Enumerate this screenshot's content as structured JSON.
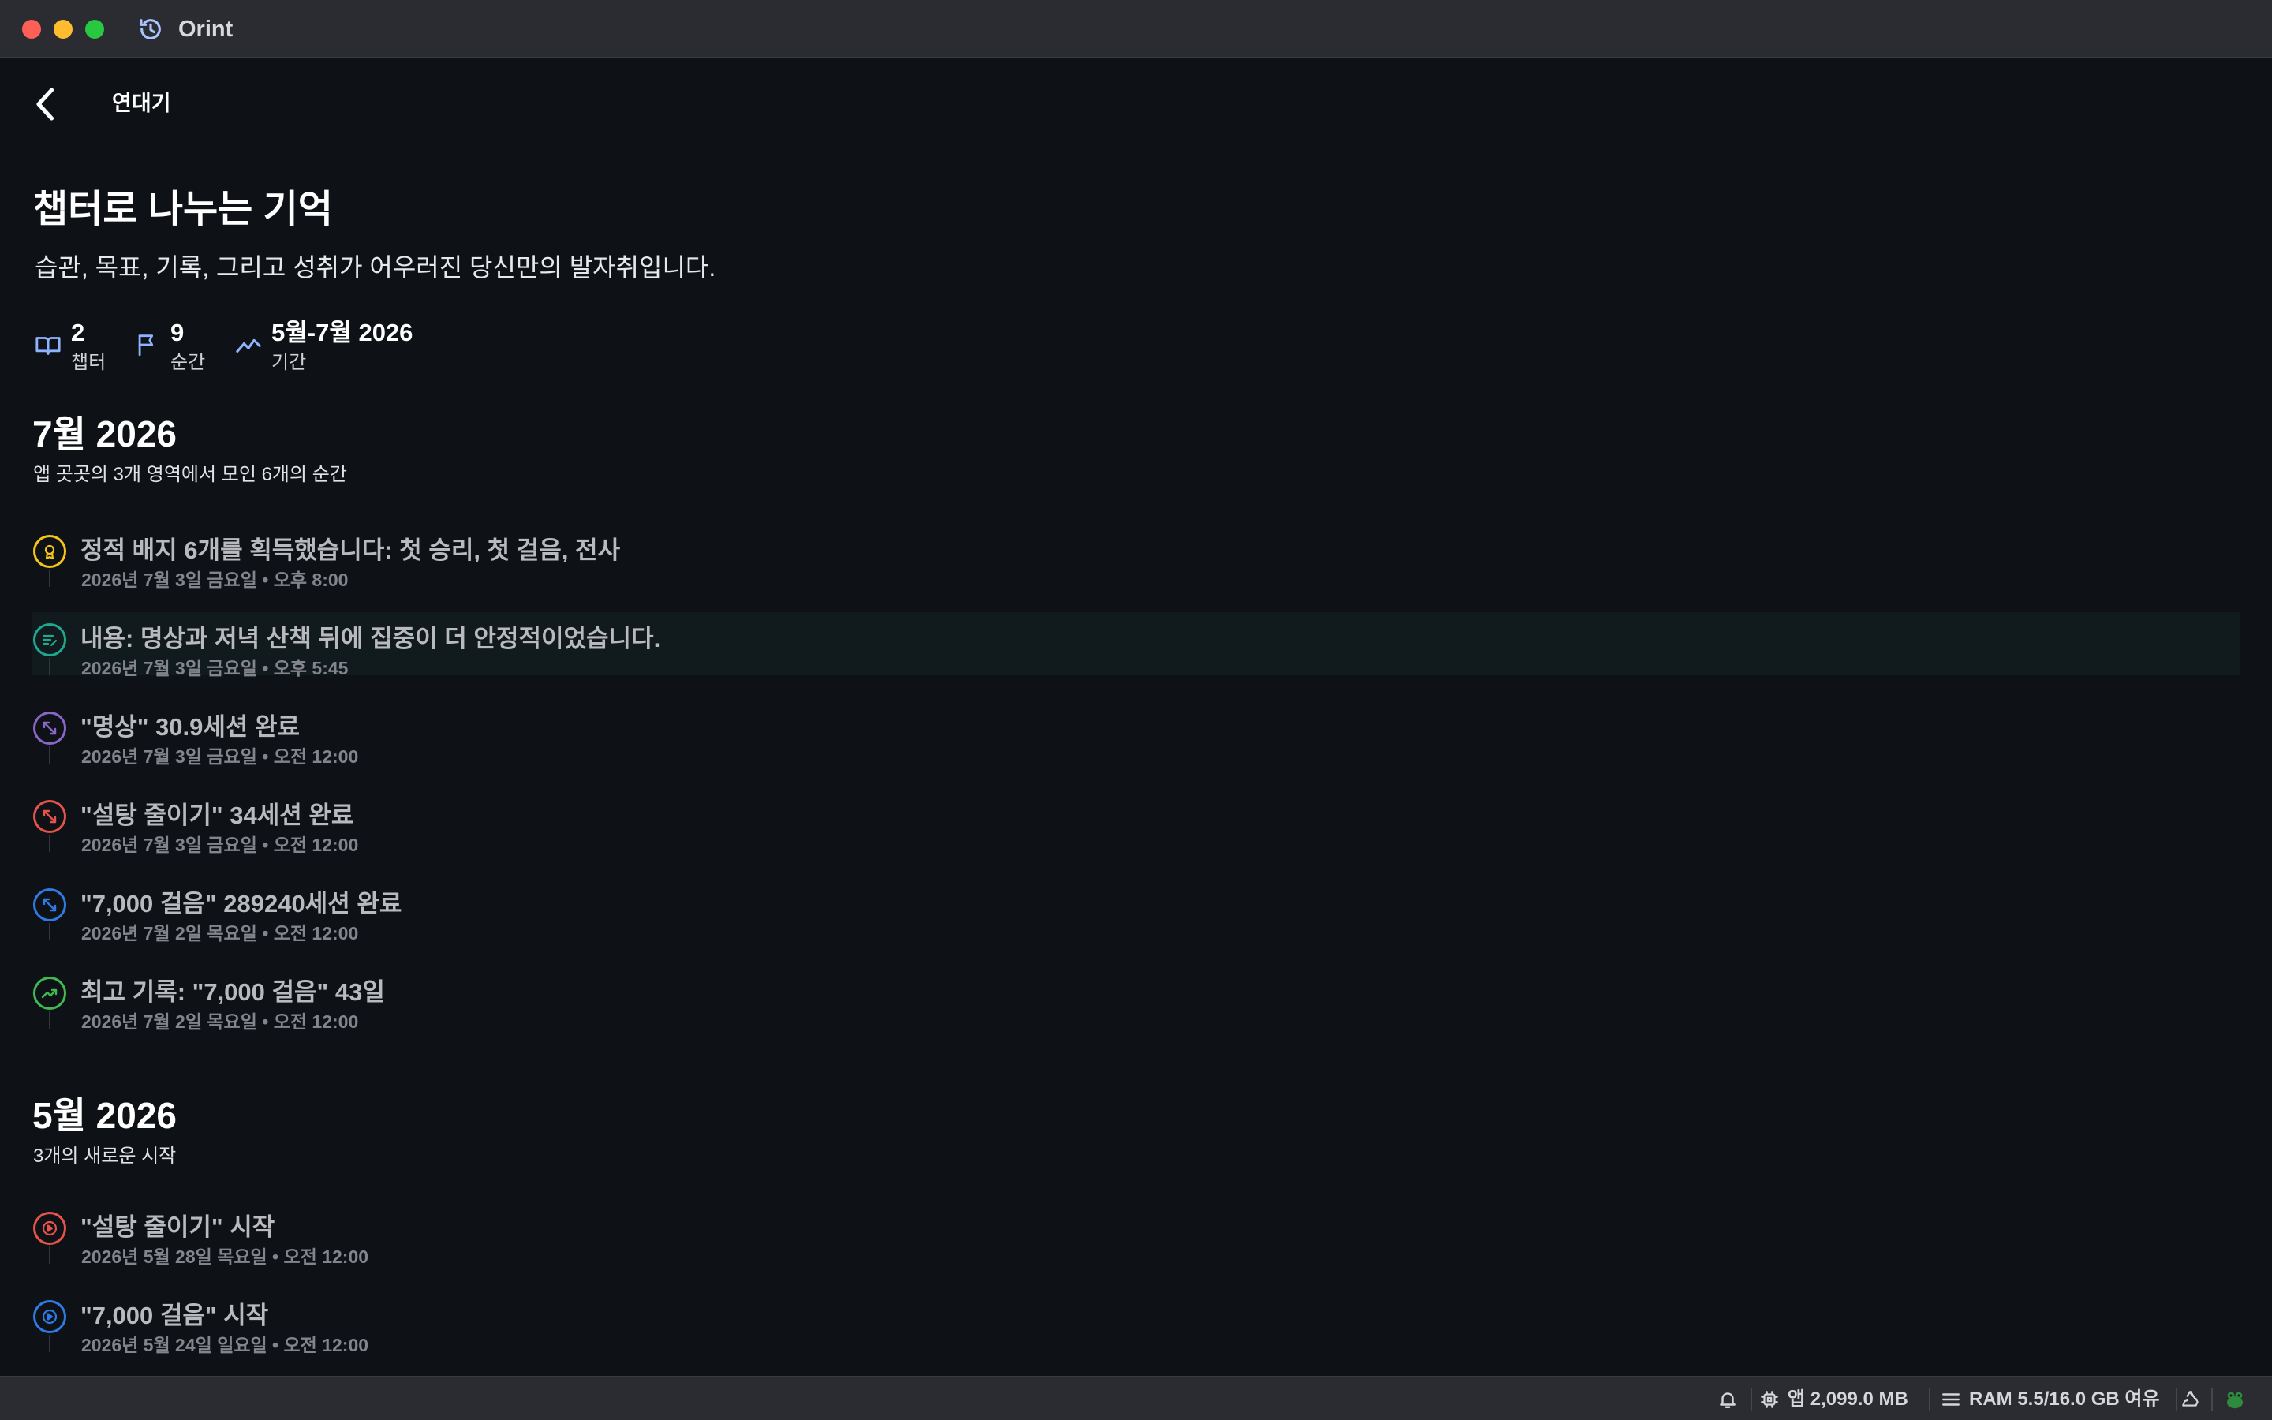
{
  "window": {
    "title": "Orint",
    "icon": "history-icon"
  },
  "nav": {
    "title": "연대기",
    "back_icon": "chevron-left-icon"
  },
  "hero": {
    "title": "챕터로 나누는 기억",
    "subtitle": "습관, 목표, 기록, 그리고 성취가 어우러진 당신만의 발자취입니다."
  },
  "stats": [
    {
      "value": "2",
      "label": "챕터",
      "icon": "open-book-icon"
    },
    {
      "value": "9",
      "label": "순간",
      "icon": "flag-icon"
    },
    {
      "value": "5월-7월 2026",
      "label": "기간",
      "icon": "trend-line-icon"
    }
  ],
  "sections": [
    {
      "title": "7월 2026",
      "subtitle": "앱 곳곳의 3개 영역에서 모인 6개의 순간",
      "events": [
        {
          "title": "정적 배지 6개를 획득했습니다: 첫 승리, 첫 걸음, 전사",
          "date": "2026년 7월 3일 금요일 • 오후 8:00",
          "icon": "badge-icon",
          "color": "#f5c518"
        },
        {
          "title": "내용: 명상과 저녁 산책 뒤에 집중이 더 안정적이었습니다.",
          "date": "2026년 7월 3일 금요일 • 오후 5:45",
          "icon": "note-edit-icon",
          "color": "#1fa88f"
        },
        {
          "title": "\"명상\" 30.9세션 완료",
          "date": "2026년 7월 3일 금요일 • 오전 12:00",
          "icon": "shrink-arrows-icon",
          "color": "#8a66c9"
        },
        {
          "title": "\"설탕 줄이기\" 34세션 완료",
          "date": "2026년 7월 3일 금요일 • 오전 12:00",
          "icon": "shrink-arrows-icon",
          "color": "#e5534b"
        },
        {
          "title": "\"7,000 걸음\" 289240세션 완료",
          "date": "2026년 7월 2일 목요일 • 오전 12:00",
          "icon": "shrink-arrows-icon",
          "color": "#2f7be6"
        },
        {
          "title": "최고 기록: \"7,000 걸음\" 43일",
          "date": "2026년 7월 2일 목요일 • 오전 12:00",
          "icon": "trend-up-icon",
          "color": "#3fb950"
        }
      ]
    },
    {
      "title": "5월 2026",
      "subtitle": "3개의 새로운 시작",
      "events": [
        {
          "title": "\"설탕 줄이기\" 시작",
          "date": "2026년 5월 28일 목요일 • 오전 12:00",
          "icon": "play-circle-icon",
          "color": "#e5534b"
        },
        {
          "title": "\"7,000 걸음\" 시작",
          "date": "2026년 5월 24일 일요일 • 오전 12:00",
          "icon": "play-circle-icon",
          "color": "#2f7be6"
        }
      ]
    }
  ],
  "statusbar": {
    "notifications_icon": "bell-icon",
    "app_memory": "앱 2,099.0 MB",
    "ram": "RAM 5.5/16.0 GB 여유",
    "recycle_icon": "recycle-icon",
    "mascot_icon": "frog-icon"
  }
}
